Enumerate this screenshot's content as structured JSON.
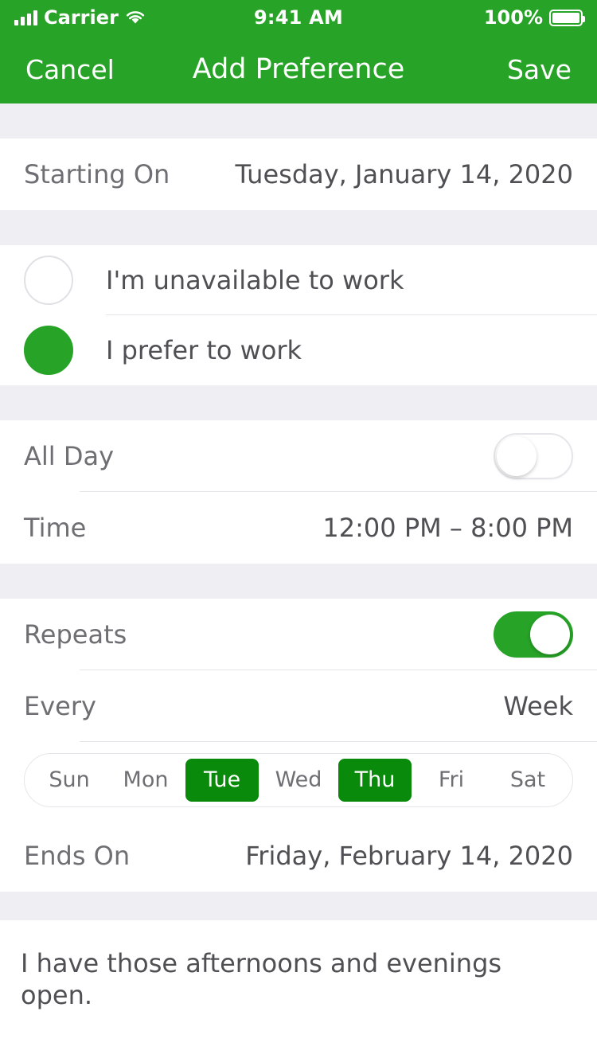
{
  "status_bar": {
    "carrier": "Carrier",
    "time": "9:41 AM",
    "battery_percent": "100%",
    "signal_icon": "signal-bars-icon",
    "wifi_icon": "wifi-icon",
    "battery_icon": "battery-full-icon"
  },
  "nav": {
    "cancel_label": "Cancel",
    "title": "Add Preference",
    "save_label": "Save"
  },
  "starting_on": {
    "label": "Starting On",
    "value": "Tuesday, January 14, 2020"
  },
  "preference": {
    "options": [
      {
        "label": "I'm unavailable to work",
        "selected": false
      },
      {
        "label": "I prefer to work",
        "selected": true
      }
    ]
  },
  "time_section": {
    "all_day_label": "All Day",
    "all_day_on": false,
    "time_label": "Time",
    "time_value": "12:00 PM – 8:00 PM"
  },
  "repeat_section": {
    "repeats_label": "Repeats",
    "repeats_on": true,
    "every_label": "Every",
    "every_value": "Week",
    "days": [
      {
        "label": "Sun",
        "selected": false
      },
      {
        "label": "Mon",
        "selected": false
      },
      {
        "label": "Tue",
        "selected": true
      },
      {
        "label": "Wed",
        "selected": false
      },
      {
        "label": "Thu",
        "selected": true
      },
      {
        "label": "Fri",
        "selected": false
      },
      {
        "label": "Sat",
        "selected": false
      }
    ],
    "ends_on_label": "Ends On",
    "ends_on_value": "Friday, February 14, 2020"
  },
  "note": {
    "text": "I have those afternoons and evenings open."
  },
  "colors": {
    "brand_green": "#27a327",
    "day_selected_green": "#0a8a0a",
    "section_gap": "#eeeef3",
    "label_gray": "#6e6e73",
    "value_gray": "#4f4f54"
  }
}
